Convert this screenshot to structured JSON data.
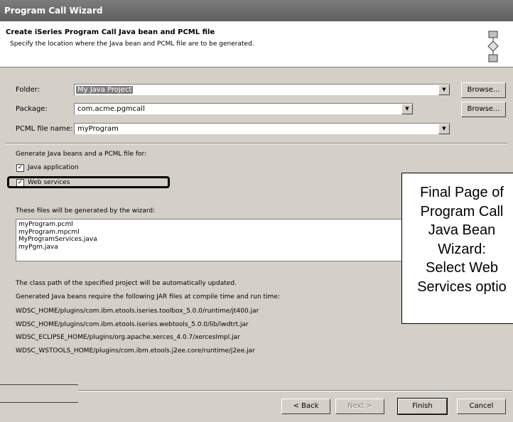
{
  "window": {
    "title": "Program Call Wizard"
  },
  "header": {
    "title": "Create iSeries Program Call Java bean and PCML file",
    "description": "Specify the location where the Java bean and PCML file are to be generated."
  },
  "form": {
    "folder_label": "Folder:",
    "folder_value": "My Java Project",
    "package_label": "Package:",
    "package_value": "com.acme.pgmcall",
    "pcml_label": "PCML file name:",
    "pcml_value": "myProgram",
    "browse1": "Browse...",
    "browse2": "Browse..."
  },
  "generate": {
    "heading": "Generate Java beans and a PCML file for:",
    "java_app": "Java application",
    "java_app_checked": true,
    "web_services": "Web services",
    "web_services_checked": true
  },
  "files": {
    "heading": "These files will be generated by the wizard:",
    "items": [
      "myProgram.pcml",
      "myProgram.mpcml",
      "MyProgramServices.java",
      "myPgm.java"
    ]
  },
  "info": {
    "line1": "The class path of the specified project will be automatically updated.",
    "line2": "Generated Java beans require the following JAR files at compile time and run time:",
    "jars": [
      "WDSC_HOME/plugins/com.ibm.etools.iseries.toolbox_5.0.0/runtime/jt400.jar",
      "WDSC_HOME/plugins/com.ibm.etools.iseries.webtools_5.0.0/lib/iwdtrt.jar",
      "WDSC_ECLIPSE_HOME/plugins/org.apache.xerces_4.0.7/xercesImpl.jar",
      "WDSC_WSTOOLS_HOME/plugins/com.ibm.etools.j2ee.core/runtime/j2ee.jar"
    ]
  },
  "buttons": {
    "back": "< Back",
    "next": "Next >",
    "finish": "Finish",
    "cancel": "Cancel"
  },
  "callout": {
    "lines": [
      "Final Page of",
      "Program Call",
      "Java Bean",
      "Wizard:",
      "Select Web",
      "Services optio"
    ]
  }
}
